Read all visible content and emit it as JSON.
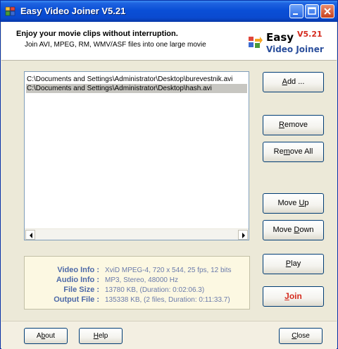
{
  "window": {
    "title": "Easy Video Joiner V5.21"
  },
  "header": {
    "title": "Enjoy your movie clips without interruption.",
    "subtitle": "Join AVI, MPEG, RM, WMV/ASF files into one large movie",
    "logo_easy": "Easy",
    "logo_version": "V5.21",
    "logo_product": "Video Joiner"
  },
  "file_list": [
    {
      "path": "C:\\Documents and Settings\\Administrator\\Desktop\\burevestnik.avi",
      "selected": false
    },
    {
      "path": "C:\\Documents and Settings\\Administrator\\Desktop\\hash.avi",
      "selected": true
    }
  ],
  "info": {
    "video_label": "Video Info :",
    "video_value": "XviD MPEG-4, 720 x 544, 25 fps, 12 bits",
    "audio_label": "Audio Info :",
    "audio_value": "MP3, Stereo, 48000 Hz",
    "size_label": "File Size :",
    "size_value": "13780 KB, (Duration: 0:02:06.3)",
    "output_label": "Output File :",
    "output_value": "135338 KB, (2 files, Duration: 0:11:33.7)"
  },
  "buttons": {
    "add": {
      "pre": "",
      "key": "A",
      "post": "dd ..."
    },
    "remove": {
      "pre": "",
      "key": "R",
      "post": "emove"
    },
    "remove_all": {
      "pre": "Re",
      "key": "m",
      "post": "ove All"
    },
    "move_up": {
      "pre": "Move ",
      "key": "U",
      "post": "p"
    },
    "move_down": {
      "pre": "Move ",
      "key": "D",
      "post": "own"
    },
    "play": {
      "pre": "",
      "key": "P",
      "post": "lay"
    },
    "join": {
      "pre": "",
      "key": "J",
      "post": "oin"
    },
    "about": {
      "pre": "A",
      "key": "b",
      "post": "out"
    },
    "help": {
      "pre": "",
      "key": "H",
      "post": "elp"
    },
    "close": {
      "pre": "",
      "key": "C",
      "post": "lose"
    }
  },
  "colors": {
    "titlebar": "#0a4fd6",
    "accent_red": "#d52b1e",
    "info_label": "#4e6aa8",
    "selection": "#c7c6c1"
  }
}
